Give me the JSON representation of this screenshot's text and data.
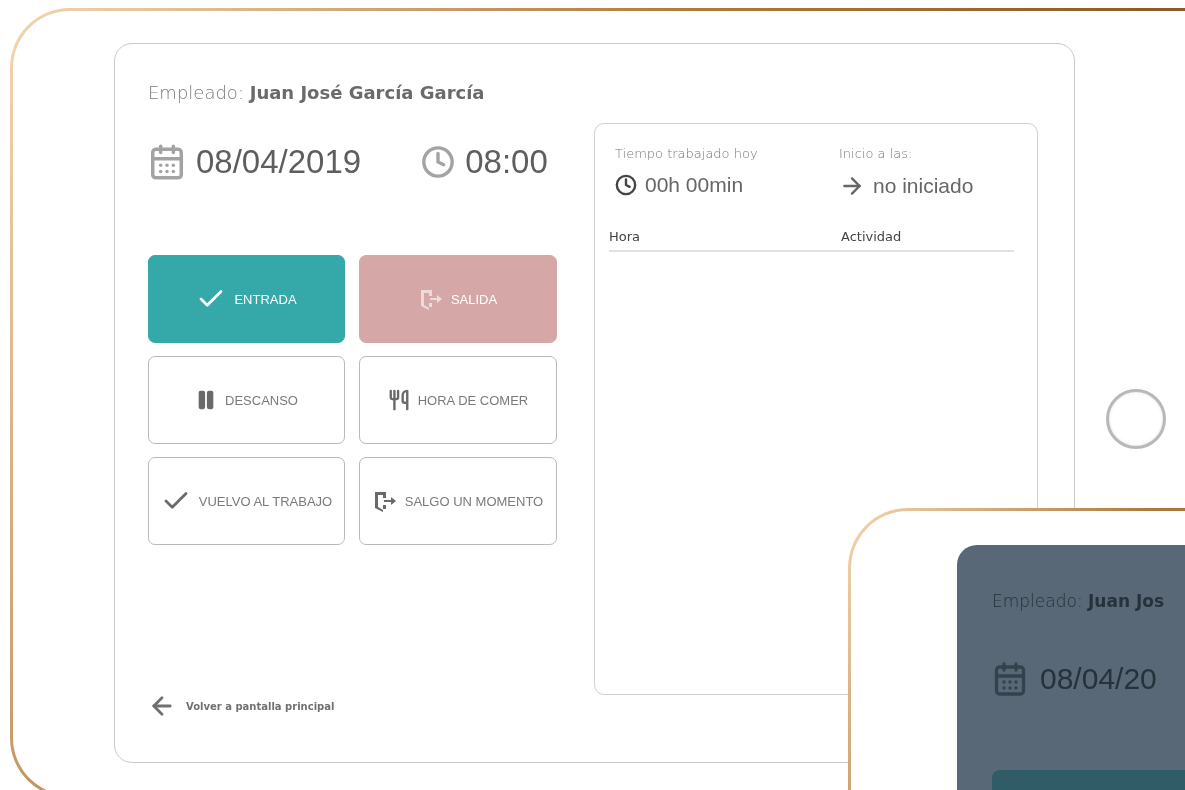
{
  "employee": {
    "label": "Empleado:",
    "name": "Juan José García García"
  },
  "date": "08/04/2019",
  "time": "08:00",
  "actions": [
    {
      "label": "ENTRADA",
      "kind": "primary",
      "disabled": false
    },
    {
      "label": "SALIDA",
      "kind": "danger",
      "disabled": true
    },
    {
      "label": "DESCANSO",
      "kind": "outline",
      "disabled": false
    },
    {
      "label": "HORA DE COMER",
      "kind": "outline",
      "disabled": false
    },
    {
      "label": "VUELVO AL TRABAJO",
      "kind": "outline",
      "disabled": false
    },
    {
      "label": "SALGO UN MOMENTO",
      "kind": "outline",
      "disabled": false
    }
  ],
  "back_link": "Volver a pantalla principal",
  "summary": {
    "worked_label": "Tiempo trabajado hoy",
    "worked_value": "00h 00min",
    "start_label": "Inicio a las:",
    "start_value": "no iniciado"
  },
  "log_columns": [
    "Hora",
    "Actividad"
  ],
  "second_device": {
    "employee_label": "Empleado:",
    "employee_name": "Juan Jos",
    "date": "08/04/20"
  }
}
